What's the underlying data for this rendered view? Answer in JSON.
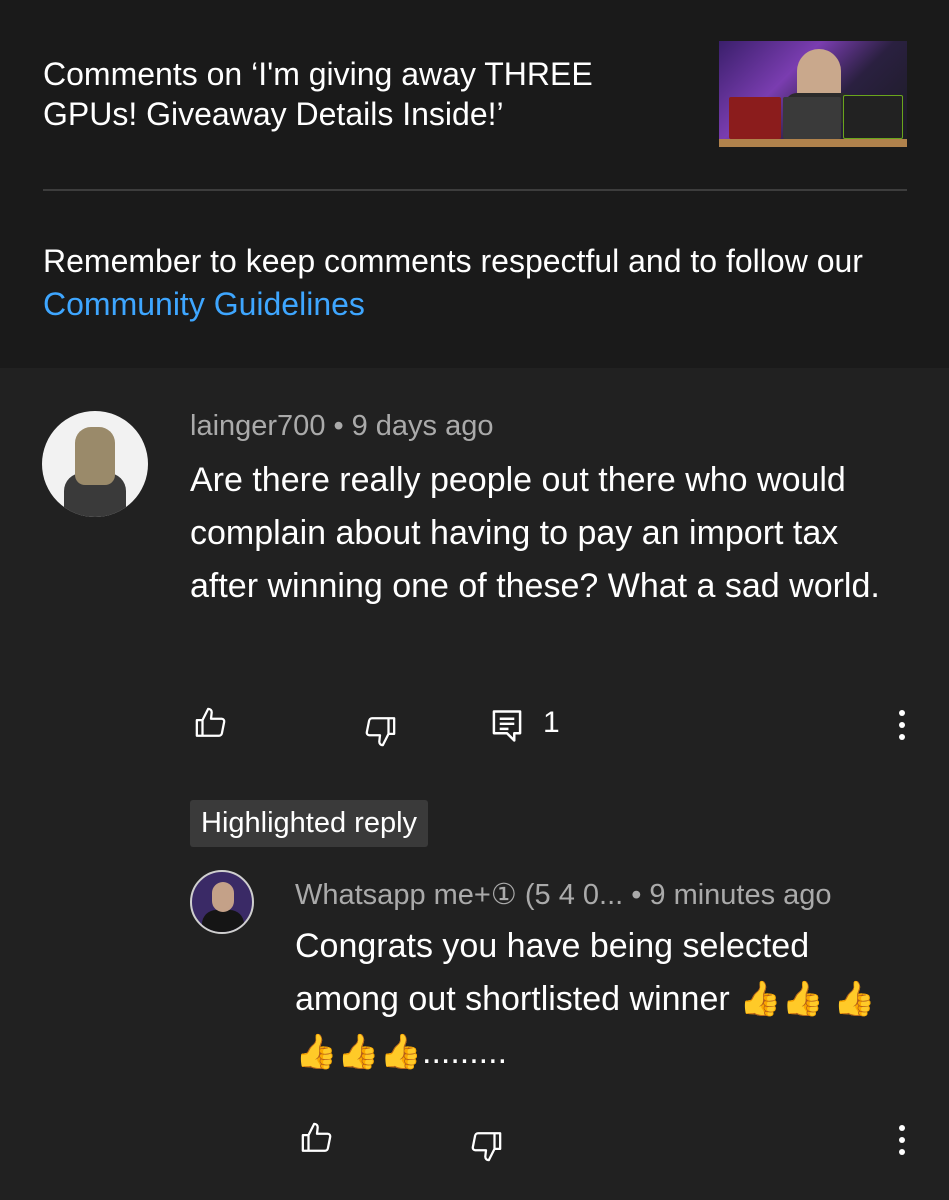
{
  "header": {
    "title": "Comments on ‘I'm giving away THREE GPUs! Giveaway Details Inside!’"
  },
  "notice": {
    "text": "Remember to keep comments respectful and to follow our ",
    "link": "Community Guidelines"
  },
  "comment": {
    "author": "lainger700",
    "separator": "•",
    "time": "9 days ago",
    "text": "Are there really people out there who would complain about having to pay an import tax after winning one of these? What a sad world.",
    "reply_count": "1"
  },
  "highlighted_label": "Highlighted reply",
  "reply": {
    "author": "Whatsapp me+① (5 4 0...",
    "separator": "•",
    "time": "9 minutes ago",
    "text": "Congrats you have being selected among out shortlisted winner 👍👍 👍👍👍👍........."
  },
  "colors": {
    "background": "#212121",
    "header_background": "#1a1a1a",
    "link": "#3ea6ff",
    "meta": "#aaaaaa"
  },
  "icons": [
    "like-icon",
    "dislike-icon",
    "reply-icon",
    "more-vert-icon"
  ]
}
